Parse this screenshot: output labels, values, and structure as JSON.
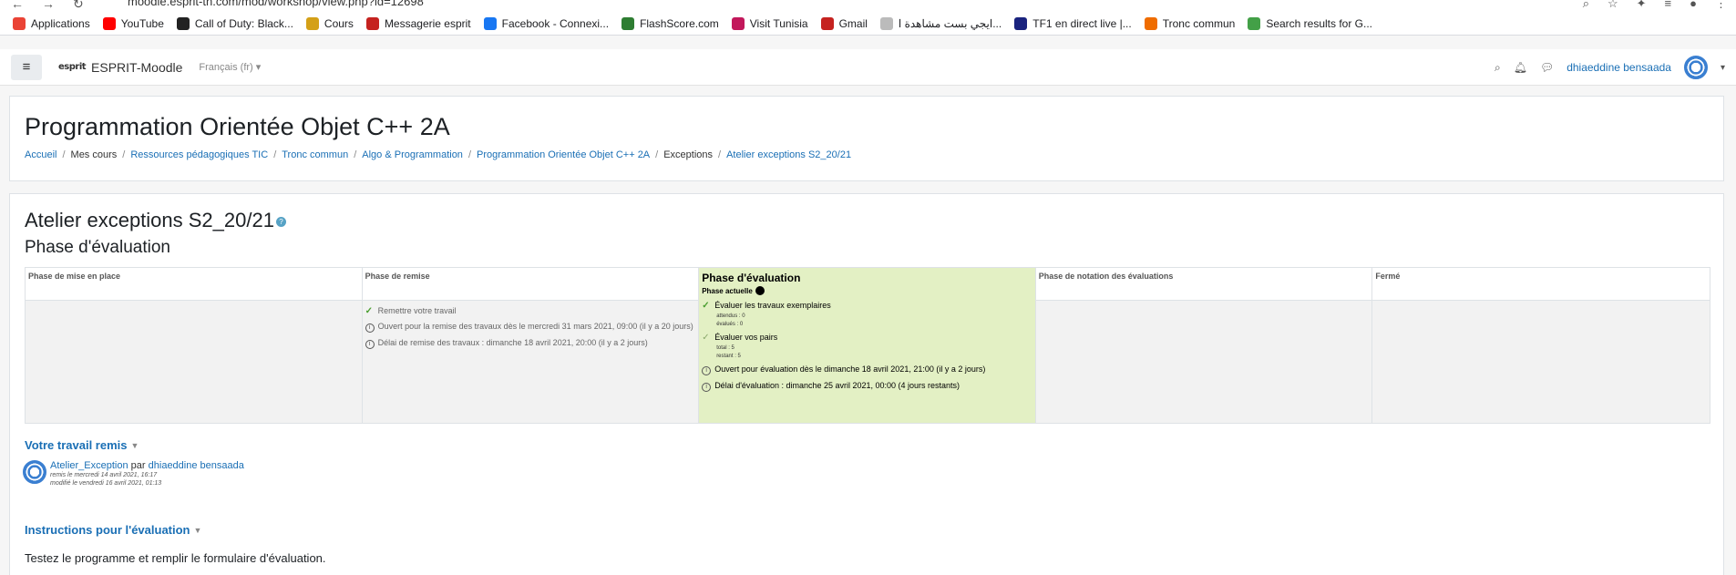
{
  "browser": {
    "url": "moodle.esprit-tn.com/mod/workshop/view.php?id=12698",
    "bookmarks": [
      {
        "label": "Applications",
        "color": "#ea4335"
      },
      {
        "label": "YouTube",
        "color": "#ff0000"
      },
      {
        "label": "Call of Duty: Black...",
        "color": "#222222"
      },
      {
        "label": "Cours",
        "color": "#d4a017"
      },
      {
        "label": "Messagerie esprit",
        "color": "#c5221f"
      },
      {
        "label": "Facebook - Connexi...",
        "color": "#1877f2"
      },
      {
        "label": "FlashScore.com",
        "color": "#2e7d32"
      },
      {
        "label": "Visit Tunisia",
        "color": "#c2185b"
      },
      {
        "label": "Gmail",
        "color": "#c5221f"
      },
      {
        "label": "ايجي بست مشاهدة ا...",
        "color": "#bbbbbb"
      },
      {
        "label": "TF1 en direct live |...",
        "color": "#1a237e"
      },
      {
        "label": "Tronc commun",
        "color": "#ef6c00"
      },
      {
        "label": "Search results for G...",
        "color": "#43a047"
      }
    ]
  },
  "navbar": {
    "logo_text": "esprit",
    "site_name": "ESPRIT-Moodle",
    "language": "Français (fr)",
    "user_name": "dhiaeddine bensaada"
  },
  "header": {
    "course_title": "Programmation Orientée Objet C++ 2A",
    "breadcrumb": [
      {
        "label": "Accueil",
        "link": true
      },
      {
        "label": "Mes cours",
        "link": false
      },
      {
        "label": "Ressources pédagogiques TIC",
        "link": true
      },
      {
        "label": "Tronc commun",
        "link": true
      },
      {
        "label": "Algo & Programmation",
        "link": true
      },
      {
        "label": "Programmation Orientée Objet C++ 2A",
        "link": true
      },
      {
        "label": "Exceptions",
        "link": false
      },
      {
        "label": "Atelier exceptions S2_20/21",
        "link": true
      }
    ]
  },
  "workshop": {
    "title": "Atelier exceptions S2_20/21",
    "current_phase_heading": "Phase d'évaluation",
    "phases": {
      "setup": "Phase de mise en place",
      "submission": "Phase de remise",
      "assessment": "Phase d'évaluation",
      "assessment_current": "Phase actuelle",
      "grading": "Phase de notation des évaluations",
      "closed": "Fermé"
    },
    "submission_tasks": {
      "t1": "Remettre votre travail",
      "t2": "Ouvert pour la remise des travaux dès le mercredi 31 mars 2021, 09:00 (il y a 20 jours)",
      "t3": "Délai de remise des travaux : dimanche 18 avril 2021, 20:00 (il y a 2 jours)"
    },
    "assessment_tasks": {
      "t1": "Évaluer les travaux exemplaires",
      "t1_a": "attendus : 0",
      "t1_b": "évalués : 0",
      "t2": "Évaluer vos pairs",
      "t2_a": "total : 5",
      "t2_b": "restant : 5",
      "t3": "Ouvert pour évaluation dès le dimanche 18 avril 2021, 21:00 (il y a 2 jours)",
      "t4": "Délai d'évaluation : dimanche 25 avril 2021, 00:00 (4 jours restants)"
    }
  },
  "submission": {
    "section_title": "Votre travail remis",
    "title": "Atelier_Exception",
    "by": "par",
    "author": "dhiaeddine bensaada",
    "submitted": "remis le mercredi 14 avril 2021, 16:17",
    "modified": "modifié le vendredi 16 avril 2021, 01:13"
  },
  "instructions": {
    "section_title": "Instructions pour l'évaluation",
    "text": "Testez le programme et remplir le formulaire d'évaluation."
  }
}
